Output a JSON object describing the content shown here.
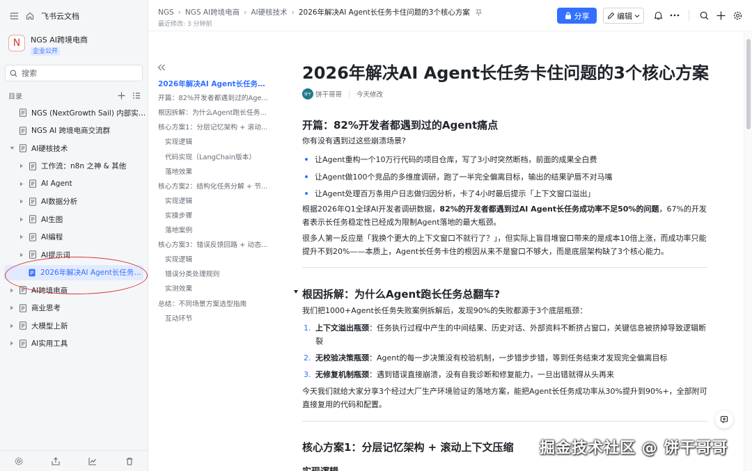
{
  "app": {
    "name": "飞书云文档"
  },
  "workspace": {
    "logo_letter": "N",
    "name": "NGS AI跨境电商",
    "badge": "企业公开"
  },
  "search": {
    "placeholder": "搜索"
  },
  "toc": {
    "label": "目录",
    "items": [
      {
        "label": "NGS (NextGrowth Sail) 内部实战手...",
        "level": 0,
        "caret": "none"
      },
      {
        "label": "NGS AI 跨境电商交流群",
        "level": 0,
        "caret": "none"
      },
      {
        "label": "AI硬核技术",
        "level": 0,
        "caret": "down"
      },
      {
        "label": "工作流：n8n 之神 & 其他",
        "level": 1,
        "caret": "right"
      },
      {
        "label": "AI Agent",
        "level": 1,
        "caret": "right"
      },
      {
        "label": "AI数据分析",
        "level": 1,
        "caret": "right"
      },
      {
        "label": "AI生图",
        "level": 1,
        "caret": "right"
      },
      {
        "label": "AI编程",
        "level": 1,
        "caret": "right"
      },
      {
        "label": "AI提示词",
        "level": 1,
        "caret": "right"
      },
      {
        "label": "2026年解决AI Agent长任务卡住...",
        "level": 1,
        "caret": "none",
        "active": true
      },
      {
        "label": "AI跨境电商",
        "level": 0,
        "caret": "right"
      },
      {
        "label": "商业思考",
        "level": 0,
        "caret": "right"
      },
      {
        "label": "大模型上新",
        "level": 0,
        "caret": "right"
      },
      {
        "label": "AI实用工具",
        "level": 0,
        "caret": "right"
      }
    ]
  },
  "header": {
    "breadcrumbs": [
      "NGS",
      "NGS AI跨境电商",
      "AI硬核技术",
      "2026年解决AI Agent长任务卡住问题的3个核心方案"
    ],
    "modified": "最近修改: 3 分钟前",
    "share_label": "分享",
    "edit_label": "编辑"
  },
  "outline": {
    "items": [
      {
        "label": "2026年解决AI Agent长任务卡...",
        "level": 0,
        "active": true
      },
      {
        "label": "开篇：82%开发者都遇到过的Age...",
        "level": 0
      },
      {
        "label": "根因拆解：为什么Agent跑长任务...",
        "level": 0
      },
      {
        "label": "核心方案1：分层记忆架构 + 滚动...",
        "level": 0
      },
      {
        "label": "实现逻辑",
        "level": 1
      },
      {
        "label": "代码实现（LangChain版本）",
        "level": 1
      },
      {
        "label": "落地效果",
        "level": 1
      },
      {
        "label": "核心方案2：结构化任务分解 + 节...",
        "level": 0
      },
      {
        "label": "实现逻辑",
        "level": 1
      },
      {
        "label": "实操步骤",
        "level": 1
      },
      {
        "label": "落地案例",
        "level": 1
      },
      {
        "label": "核心方案3：错误反馈回路 + 动态...",
        "level": 0
      },
      {
        "label": "实现逻辑",
        "level": 1
      },
      {
        "label": "错误分类处理规则",
        "level": 1
      },
      {
        "label": "实测效果",
        "level": 1
      },
      {
        "label": "总结：不同场景方案选型指南",
        "level": 0
      },
      {
        "label": "互动环节",
        "level": 1
      }
    ]
  },
  "doc": {
    "title": "2026年解决AI Agent长任务卡住问题的3个核心方案",
    "author": "饼干哥哥",
    "avatar_text": "饼干",
    "edit_time": "今天修改",
    "s1": {
      "heading": "开篇：82%开发者都遇到过的Agent痛点",
      "intro": "你有没有遇到过这些崩溃场景?",
      "bullets": [
        "让Agent重构一个10万行代码的项目仓库，写了3小时突然断档，前面的成果全白费",
        "让Agent做100个竞品的多维度调研，跑了一半完全偏离目标，输出的结果驴唇不对马嘴",
        "让Agent处理百万条用户日志做归因分析，卡了4小时最后提示「上下文窗口溢出」"
      ],
      "p1_a": "根据2026年Q1全球AI开发者调研数据，",
      "p1_b": "82%的开发者都遇到过AI Agent长任务成功率不足50%的问题",
      "p1_c": "，67%的开发者表示长任务稳定性已经成为限制Agent落地的最大瓶颈。",
      "p2": "很多人第一反应是「我换个更大的上下文窗口不就行了？」，但实际上盲目堆窗口带来的是成本10倍上涨，而成功率只能提升不到20%——本质上，Agent长任务卡住的根因从来不是窗口不够大，而是底层架构缺了3个核心能力。"
    },
    "s2": {
      "heading": "根因拆解：为什么Agent跑长任务总翻车?",
      "intro": "我们把1000+Agent长任务失败案例拆解后，发现90%的失败都源于3个底层瓶颈：",
      "items": [
        {
          "n": "1.",
          "title": "上下文溢出瓶颈",
          "text": "：任务执行过程中产生的中间结果、历史对话、外部资料不断挤占窗口，关键信息被挤掉导致逻辑断裂"
        },
        {
          "n": "2.",
          "title": "无校验决策瓶颈",
          "text": "：Agent的每一步决策没有校验机制，一步错步步错，等到任务结束才发现完全偏离目标"
        },
        {
          "n": "3.",
          "title": "无修复机制瓶颈",
          "text": "：遇到错误直接崩溃，没有自我诊断和修复能力，一旦出错就得从头再来"
        }
      ],
      "outro": "今天我们就给大家分享3个经过大厂生产环境验证的落地方案，能把Agent长任务成功率从30%提升到90%+，全部附可直接复用的代码和配置。"
    },
    "s3": {
      "heading": "核心方案1：分层记忆架构 + 滚动上下文压缩",
      "sub": "实现逻辑"
    }
  },
  "watermark": "掘金技术社区 @ 饼干哥哥",
  "colors": {
    "accent": "#3370ff",
    "annotation": "#d8353a"
  }
}
